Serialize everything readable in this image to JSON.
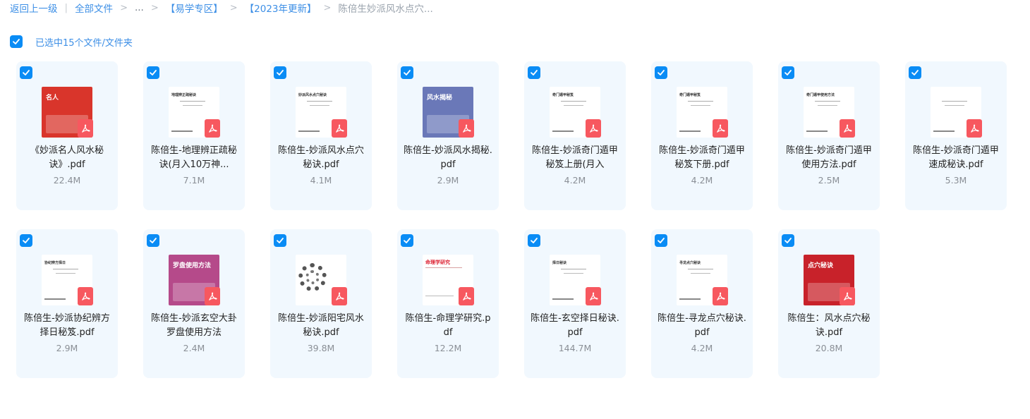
{
  "breadcrumb": {
    "back": "返回上一级",
    "items": [
      "全部文件",
      "...",
      "【易学专区】",
      "【2023年更新】",
      "陈倍生妙派风水点穴..."
    ]
  },
  "selection": {
    "text": "已选中15个文件/文件夹"
  },
  "colors": {
    "accent": "#0a8cf5",
    "link": "#3d8fe6",
    "card_bg": "#f1f8fe",
    "pdf_red": "#f7585f"
  },
  "files": [
    {
      "name": "《妙派名人风水秘诀》.pdf",
      "size": "22.4M",
      "thumb": "名人"
    },
    {
      "name": "陈倍生-地理辨正疏秘诀(月入10万神...",
      "size": "7.1M",
      "thumb": "地理辨正疏秘诀"
    },
    {
      "name": "陈倍生-妙派风水点穴秘诀.pdf",
      "size": "4.1M",
      "thumb": "妙派风水点穴秘诀"
    },
    {
      "name": "陈倍生-妙派风水揭秘.pdf",
      "size": "2.9M",
      "thumb": "风水揭秘"
    },
    {
      "name": "陈倍生-妙派奇门遁甲秘笈上册(月入",
      "size": "4.2M",
      "thumb": "奇门遁甲秘笈"
    },
    {
      "name": "陈倍生-妙派奇门遁甲秘笈下册.pdf",
      "size": "4.2M",
      "thumb": "奇门遁甲秘笈"
    },
    {
      "name": "陈倍生-妙派奇门遁甲使用方法.pdf",
      "size": "2.5M",
      "thumb": "奇门遁甲使用方法"
    },
    {
      "name": "陈倍生-妙派奇门遁甲速成秘诀.pdf",
      "size": "5.3M",
      "thumb": ""
    },
    {
      "name": "陈倍生-妙派协纪辨方择日秘笈.pdf",
      "size": "2.9M",
      "thumb": "协纪辨方择日"
    },
    {
      "name": "陈倍生-妙派玄空大卦罗盘使用方法",
      "size": "2.4M",
      "thumb": "罗盘使用方法"
    },
    {
      "name": "陈倍生-妙派阳宅风水秘诀.pdf",
      "size": "39.8M",
      "thumb": ""
    },
    {
      "name": "陈倍生-命理学研究.pdf",
      "size": "12.2M",
      "thumb": "命理学研究"
    },
    {
      "name": "陈倍生-玄空择日秘诀.pdf",
      "size": "144.7M",
      "thumb": "择日秘诀"
    },
    {
      "name": "陈倍生-寻龙点穴秘诀.pdf",
      "size": "4.2M",
      "thumb": "寻龙点穴秘诀"
    },
    {
      "name": "陈倍生：风水点穴秘诀.pdf",
      "size": "20.8M",
      "thumb": "点穴秘诀"
    }
  ]
}
